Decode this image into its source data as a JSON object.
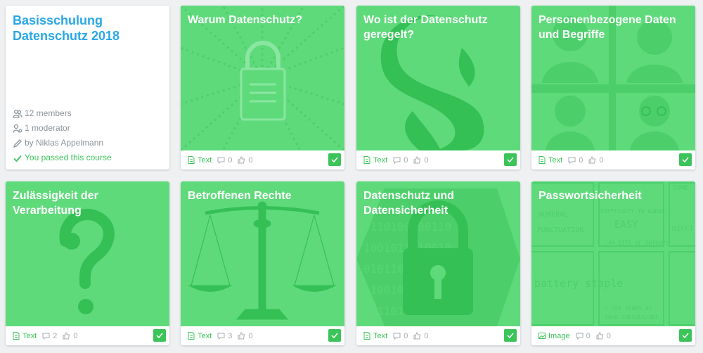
{
  "course": {
    "title": "Basisschulung Datenschutz 2018",
    "members": "12 members",
    "moderators": "1 moderator",
    "author": "by Niklas Appelmann",
    "status": "You passed this course"
  },
  "colors": {
    "accent_blue": "#29a7e6",
    "cover_green": "#5fda7b",
    "passed_green": "#3cc45a"
  },
  "chapters": [
    {
      "title": "Warum Datenschutz?",
      "type": "Text",
      "comments": "0",
      "likes": "0",
      "completed": true,
      "icon": "padlock-icon"
    },
    {
      "title": "Wo ist der Datenschutz geregelt?",
      "type": "Text",
      "comments": "0",
      "likes": "0",
      "completed": true,
      "icon": "paragraph-icon"
    },
    {
      "title": "Personenbezogene Daten und Begriffe",
      "type": "Text",
      "comments": "0",
      "likes": "0",
      "completed": true,
      "icon": "people-icon"
    },
    {
      "title": "Zulässigkeit der Verarbeitung",
      "type": "Text",
      "comments": "2",
      "likes": "0",
      "completed": true,
      "icon": "question-mark-icon"
    },
    {
      "title": "Betroffenen Rechte",
      "type": "Text",
      "comments": "3",
      "likes": "0",
      "completed": true,
      "icon": "scales-icon"
    },
    {
      "title": "Datenschutz und Datensicherheit",
      "type": "Text",
      "comments": "0",
      "likes": "0",
      "completed": true,
      "icon": "secure-lock-icon"
    },
    {
      "title": "Passwortsicherheit",
      "type": "Image",
      "comments": "0",
      "likes": "0",
      "completed": true,
      "icon": "comic-icon",
      "comic_text": [
        "NUMERAL",
        "PUNCTUATION",
        "DIFFICULTY TO GUESS:",
        "EASY",
        "~44 BITS OF ENTROPY",
        "battery staple",
        "= 550 YEARS AT",
        "1000 GUESSES/SEC",
        "SOME",
        "DIFFI"
      ]
    }
  ]
}
